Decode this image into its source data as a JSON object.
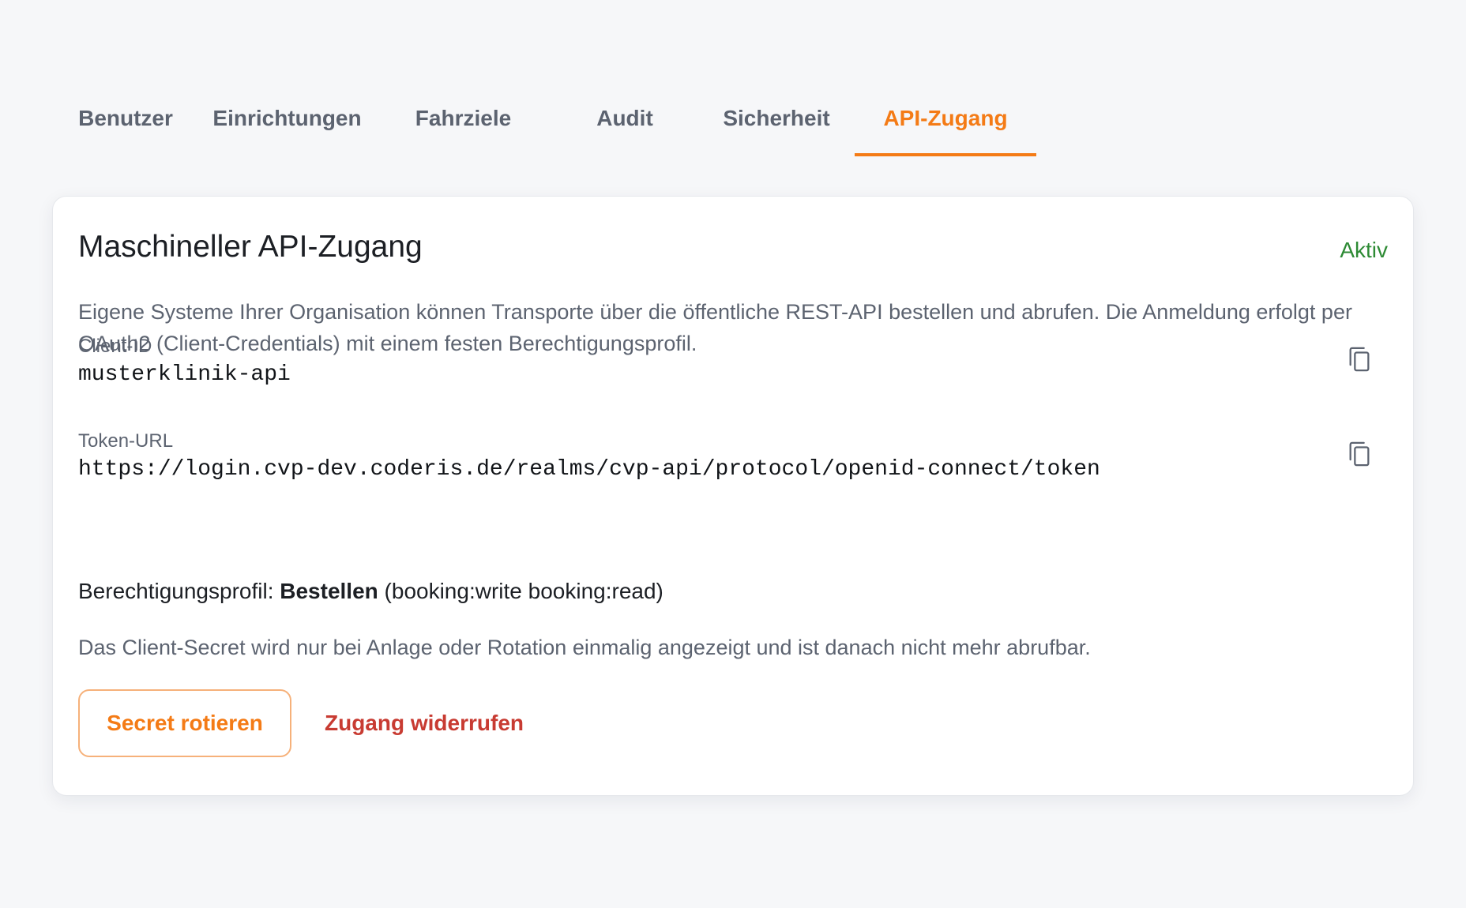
{
  "tabs": [
    {
      "label": "Benutzer",
      "active": false
    },
    {
      "label": "Einrichtungen",
      "active": false
    },
    {
      "label": "Fahrziele",
      "active": false
    },
    {
      "label": "Audit",
      "active": false
    },
    {
      "label": "Sicherheit",
      "active": false
    },
    {
      "label": "API-Zugang",
      "active": true
    }
  ],
  "card": {
    "title": "Maschineller API-Zugang",
    "status": "Aktiv",
    "description": "Eigene Systeme Ihrer Organisation können Transporte über die öffentliche REST-API bestellen und abrufen. Die Anmeldung erfolgt per OAuth2 (Client-Credentials) mit einem festen Berechtigungsprofil.",
    "client_id": {
      "label": "Client-ID",
      "value": "musterklinik-api",
      "copy_icon": "copy-icon"
    },
    "token_url": {
      "label": "Token-URL",
      "value": "https://login.cvp-dev.coderis.de/realms/cvp-api/protocol/openid-connect/token",
      "copy_icon": "copy-icon"
    },
    "profile": {
      "prefix": "Berechtigungsprofil: ",
      "name": "Bestellen",
      "scopes": " (booking:write booking:read)"
    },
    "secret_note": "Das Client-Secret wird nur bei Anlage oder Rotation einmalig angezeigt und ist danach nicht mehr abrufbar.",
    "actions": {
      "rotate_label": "Secret rotieren",
      "revoke_label": "Zugang widerrufen"
    }
  },
  "colors": {
    "accent": "#f47b16",
    "status_active": "#2d8a34",
    "danger": "#c83b32",
    "muted_text": "#5c6370",
    "background": "#f6f7f9"
  }
}
